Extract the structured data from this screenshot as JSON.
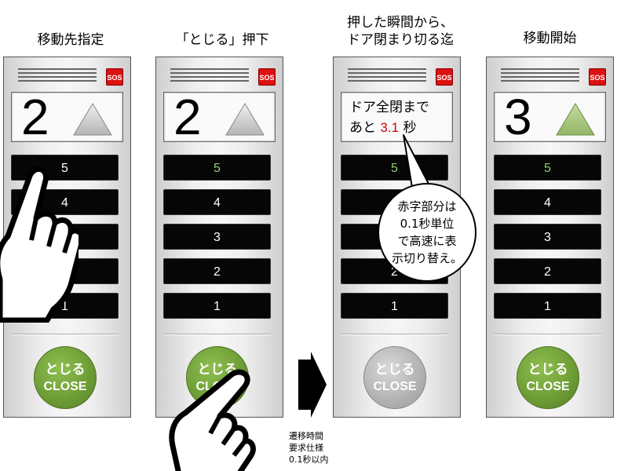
{
  "steps": [
    {
      "title": "移動先指定",
      "sos": "SOS",
      "floor": "2",
      "buttons": [
        "5",
        "4",
        "3",
        "2",
        "1"
      ],
      "lit_floor": "",
      "close_jp": "とじる",
      "close_en": "CLOSE"
    },
    {
      "title": "「とじる」押下",
      "sos": "SOS",
      "floor": "2",
      "buttons": [
        "5",
        "4",
        "3",
        "2",
        "1"
      ],
      "lit_floor": "5",
      "close_jp": "とじる",
      "close_en": "CLOSE"
    },
    {
      "title": "押した瞬間から、\nドア閉まり切る迄",
      "sos": "SOS",
      "message_prefix": "ドア全閉まで",
      "message_line2_prefix": "あと",
      "message_countdown": "3.1",
      "message_suffix": "秒",
      "buttons": [
        "5",
        "4",
        "3",
        "2",
        "1"
      ],
      "lit_floor": "5",
      "close_jp": "とじる",
      "close_en": "CLOSE"
    },
    {
      "title": "移動開始",
      "sos": "SOS",
      "floor": "3",
      "buttons": [
        "5",
        "4",
        "3",
        "2",
        "1"
      ],
      "lit_floor": "5",
      "close_jp": "とじる",
      "close_en": "CLOSE"
    }
  ],
  "callout": "赤字部分は\n0.1秒単位\nで高速に表\n示切り替え。",
  "transition_note": "遷移時間\n要求仕様\n0.1秒以内",
  "colors": {
    "red_text": "#d00000",
    "lit_button_text": "#90d070",
    "close_green": "#6f9e36",
    "close_gray": "#b5b5b5",
    "sos_red": "#dd1111",
    "triangle_gray": "#c8c8c8",
    "triangle_green": "#a6c47a"
  },
  "icons": [
    "up-arrow-triangle-icon",
    "pointing-hand-icon",
    "right-arrow-icon",
    "speech-bubble-icon"
  ]
}
